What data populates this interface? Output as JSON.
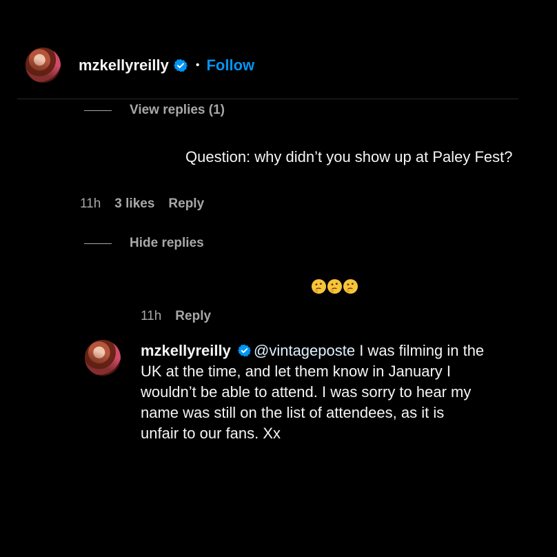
{
  "header": {
    "username": "mzkellyreilly",
    "separator": "•",
    "follow_label": "Follow"
  },
  "comments": [
    {
      "view_replies_label": "View replies (1)",
      "text": "Question: why didn’t you show up at Paley Fest?",
      "time": "11h",
      "likes": "3 likes",
      "reply_label": "Reply",
      "hide_replies_label": "Hide replies"
    }
  ],
  "reply_emoji_comment": {
    "emoji": "🤔🤔🤔",
    "time": "11h",
    "reply_label": "Reply"
  },
  "owner_reply": {
    "username": "mzkellyreilly",
    "mention": "@vintageposte",
    "lines": [
      " I was filming in the",
      "UK at the time, and let them know in January I",
      "wouldn’t be able to attend. I was sorry to hear my",
      "name was still on the list of attendees, as it is",
      "unfair to our fans. Xx"
    ]
  },
  "colors": {
    "background": "#000000",
    "text": "#f5f5f5",
    "muted": "#a8a8a8",
    "accent": "#0095f6",
    "verified": "#0095f6"
  },
  "icons": {
    "verified": "verified-badge-icon",
    "emoji": "thinking-face-icon"
  }
}
